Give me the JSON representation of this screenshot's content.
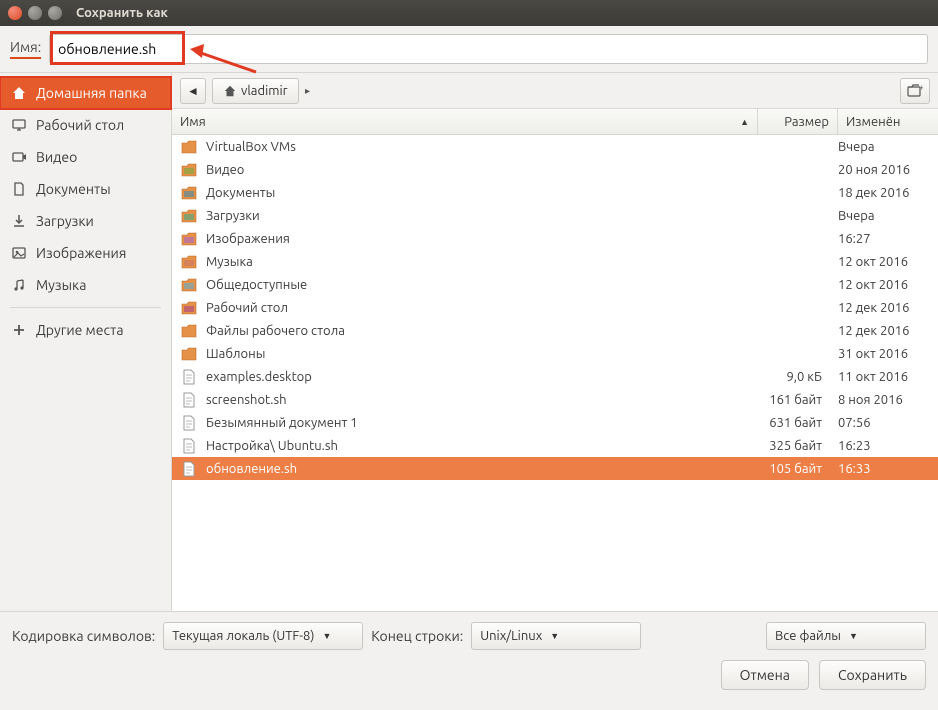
{
  "window": {
    "title": "Сохранить как"
  },
  "name_field": {
    "label": "Имя:",
    "value": "обновление.sh"
  },
  "sidebar": {
    "items": [
      {
        "label": "Домашняя папка",
        "icon": "home",
        "active": true
      },
      {
        "label": "Рабочий стол",
        "icon": "desktop"
      },
      {
        "label": "Видео",
        "icon": "video"
      },
      {
        "label": "Документы",
        "icon": "document"
      },
      {
        "label": "Загрузки",
        "icon": "download"
      },
      {
        "label": "Изображения",
        "icon": "image"
      },
      {
        "label": "Музыка",
        "icon": "music"
      }
    ],
    "other": {
      "label": "Другие места",
      "icon": "plus"
    }
  },
  "breadcrumb": {
    "current": "vladimir"
  },
  "columns": {
    "name": "Имя",
    "size": "Размер",
    "modified": "Изменён"
  },
  "files": [
    {
      "name": "VirtualBox VMs",
      "size": "",
      "modified": "Вчера",
      "icon": "folder"
    },
    {
      "name": "Видео",
      "size": "",
      "modified": "20 ноя 2016",
      "icon": "folder-video"
    },
    {
      "name": "Документы",
      "size": "",
      "modified": "18 дек 2016",
      "icon": "folder-doc"
    },
    {
      "name": "Загрузки",
      "size": "",
      "modified": "Вчера",
      "icon": "folder-dl"
    },
    {
      "name": "Изображения",
      "size": "",
      "modified": "16:27",
      "icon": "folder-img"
    },
    {
      "name": "Музыка",
      "size": "",
      "modified": "12 окт 2016",
      "icon": "folder-music"
    },
    {
      "name": "Общедоступные",
      "size": "",
      "modified": "12 окт 2016",
      "icon": "folder-public"
    },
    {
      "name": "Рабочий стол",
      "size": "",
      "modified": "12 дек 2016",
      "icon": "folder-desktop"
    },
    {
      "name": "Файлы рабочего стола",
      "size": "",
      "modified": "12 дек 2016",
      "icon": "folder"
    },
    {
      "name": "Шаблоны",
      "size": "",
      "modified": "31 окт 2016",
      "icon": "folder"
    },
    {
      "name": "examples.desktop",
      "size": "9,0 кБ",
      "modified": "11 окт 2016",
      "icon": "file"
    },
    {
      "name": "screenshot.sh",
      "size": "161 байт",
      "modified": "8 ноя 2016",
      "icon": "file"
    },
    {
      "name": "Безымянный документ 1",
      "size": "631 байт",
      "modified": "07:56",
      "icon": "file"
    },
    {
      "name": "Настройка\\ Ubuntu.sh",
      "size": "325 байт",
      "modified": "16:23",
      "icon": "file"
    },
    {
      "name": "обновление.sh",
      "size": "105 байт",
      "modified": "16:33",
      "icon": "file",
      "selected": true
    }
  ],
  "options": {
    "encoding_label": "Кодировка символов:",
    "encoding_value": "Текущая локаль (UTF-8)",
    "lineend_label": "Конец строки:",
    "lineend_value": "Unix/Linux",
    "filter_value": "Все файлы"
  },
  "buttons": {
    "cancel": "Отмена",
    "save": "Сохранить"
  }
}
